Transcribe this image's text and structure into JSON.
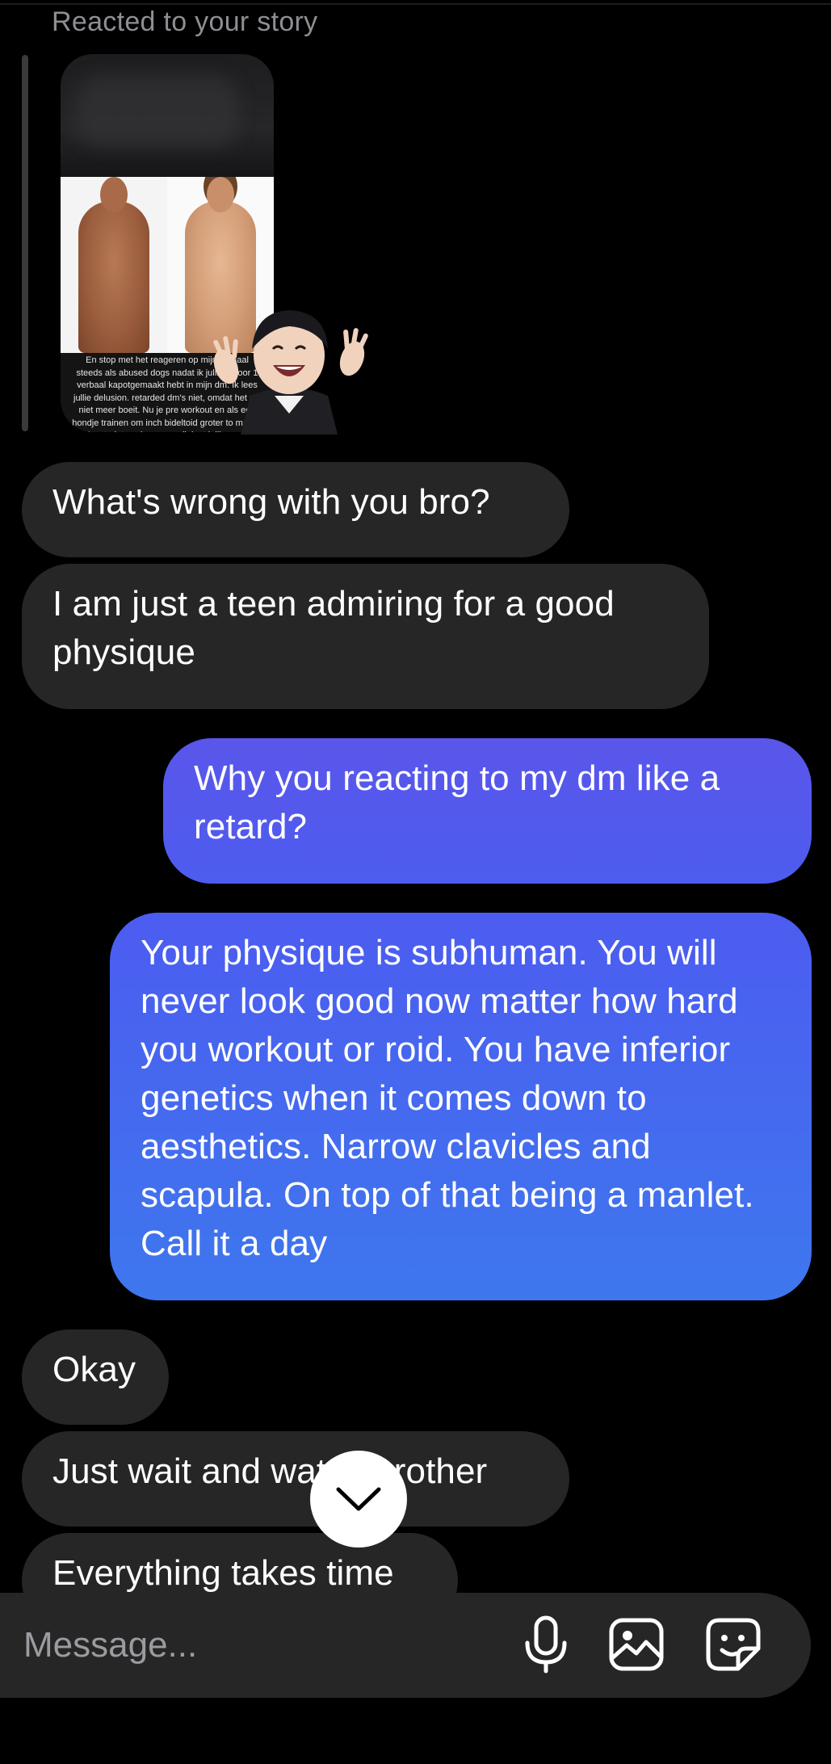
{
  "story": {
    "caption": "Reacted to your story",
    "overlay_text": "En stop met het reageren op mijn verhaal steeds als abused dogs nadat ik jullie 1 voor 1 verbaal kapotgemaakt hebt in mijn dm. Ik lees jullie delusion. retarded dm's niet, omdat het mij niet meer boeit. Nu je pre workout en als een hondje trainen om inch bideltoid groter to maken (gaat niet werken, maar ik laat jullie cope"
  },
  "messages": [
    {
      "side": "in",
      "text": "What's wrong with you bro?"
    },
    {
      "side": "in",
      "text": "I am just a teen admiring for a good physique"
    },
    {
      "side": "out",
      "text": "Why you reacting to my dm like a retard?"
    },
    {
      "side": "out",
      "text": "Your physique is subhuman. You will never look good now matter how hard you workout or roid. You have inferior genetics when it comes down to aesthetics. Narrow clavicles and scapula. On top of that being a manlet. Call it a day"
    },
    {
      "side": "in",
      "text": "Okay"
    },
    {
      "side": "in",
      "text": "Just wait and watch brother"
    },
    {
      "side": "in",
      "text": "Everything takes time"
    }
  ],
  "composer": {
    "placeholder": "Message...",
    "icons": [
      "microphone-icon",
      "gallery-icon",
      "sticker-icon"
    ]
  },
  "scroll_button": {
    "icon": "chevron-down-icon"
  },
  "colors": {
    "incoming_bubble": "#262626",
    "outgoing_top": "#5a56ea",
    "outgoing_bottom": "#3e77ee",
    "background": "#000000"
  }
}
